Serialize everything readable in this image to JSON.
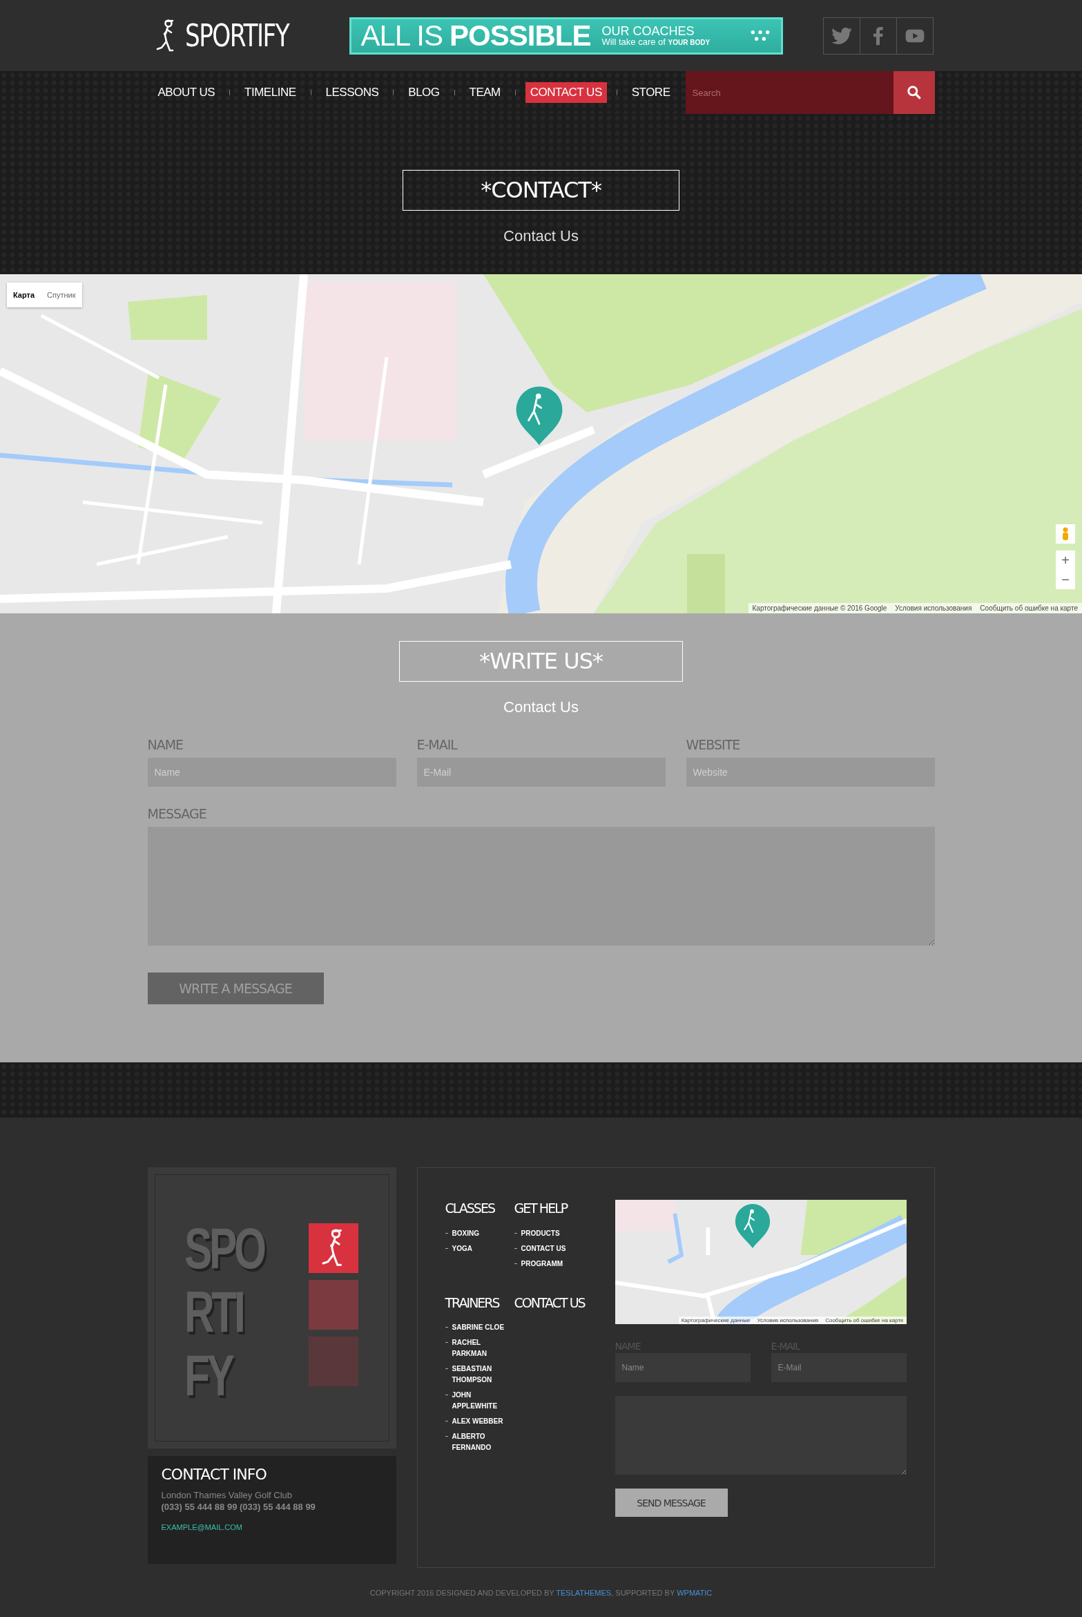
{
  "header": {
    "logo": "SPORTIFY",
    "banner": {
      "headline_light": "ALL IS",
      "headline_bold": "POSSIBLE",
      "line_1": "OUR COACHES",
      "line_2": "Will take care of **YOUR BODY**"
    },
    "social": [
      {
        "kind": "twitter"
      },
      {
        "kind": "facebook"
      },
      {
        "kind": "youtube"
      }
    ]
  },
  "nav": {
    "items": [
      {
        "label": "ABOUT US",
        "selected": false
      },
      {
        "label": "TIMELINE",
        "selected": false
      },
      {
        "label": "LESSONS",
        "selected": false
      },
      {
        "label": "BLOG",
        "selected": false
      },
      {
        "label": "TEAM",
        "selected": false
      },
      {
        "label": "CONTACT US",
        "selected": true
      },
      {
        "label": "STORE",
        "selected": false
      }
    ],
    "search": {
      "placeholder": "Search"
    }
  },
  "hero": {
    "title": "*CONTACT*",
    "subtitle": "Contact Us"
  },
  "map": {
    "map_types": [
      {
        "label": "Карта",
        "selected": true
      },
      {
        "label": "Спутник",
        "selected": false
      }
    ],
    "zoom_in": "+",
    "zoom_out": "−",
    "attribution": [
      "Картографические данные © 2016 Google",
      "Условия использования",
      "Сообщить об ошибке на карте"
    ]
  },
  "form": {
    "title": "*WRITE US*",
    "subtitle": "Contact Us",
    "fields": [
      {
        "label": "NAME",
        "placeholder": "Name"
      },
      {
        "label": "E-MAIL",
        "placeholder": "E-Mail"
      },
      {
        "label": "WEBSITE",
        "placeholder": "Website"
      }
    ],
    "message_label": "MESSAGE",
    "button": "WRITE A MESSAGE"
  },
  "footer": {
    "logo_lines": [
      "SPO",
      "RTI",
      "FY"
    ],
    "tiles": [
      {
        "kind": "logo",
        "color": "#d8323f"
      },
      {
        "kind": "plain",
        "color": "#7a3a40"
      },
      {
        "kind": "plain",
        "color": "#5a373b"
      }
    ],
    "contact_info": {
      "title": "CONTACT INFO",
      "address": "London Thames Valley Golf Club",
      "phone": "(033) 55 444 88 99 (033) 55 444 88 99",
      "email": "EXAMPLE@MAIL.COM"
    },
    "menus": [
      {
        "title": "CLASSES",
        "items": [
          "BOXING",
          "YOGA"
        ]
      },
      {
        "title": "GET HELP",
        "items": [
          "PRODUCTS",
          "CONTACT US",
          "PROGRAMM"
        ]
      },
      {
        "title": "TRAINERS",
        "items": [
          "SABRINE CLOE",
          "RACHEL PARKMAN",
          "SEBASTIAN THOMPSON",
          "JOHN APPLEWHITE",
          "ALEX WEBBER",
          "ALBERTO FERNANDO"
        ]
      },
      {
        "title": "CONTACT US"
      }
    ],
    "mini_map": {
      "attribution": [
        "Картографические данные",
        "Условия использования",
        "Сообщить об ошибке на карте"
      ]
    },
    "mini_form": {
      "fields": [
        {
          "label": "NAME",
          "placeholder": "Name"
        },
        {
          "label": "E-MAIL",
          "placeholder": "E-Mail"
        }
      ],
      "button": "SEND MESSAGE"
    },
    "copyright": [
      {
        "kind": "text",
        "text": "COPYRIGHT 2016 DESIGNED AND DEVELOPED BY "
      },
      {
        "kind": "link",
        "text": "TESLATHEMES"
      },
      {
        "kind": "text",
        "text": ", SUPPORTED BY "
      },
      {
        "kind": "link",
        "text": "WPMATIC"
      }
    ]
  }
}
